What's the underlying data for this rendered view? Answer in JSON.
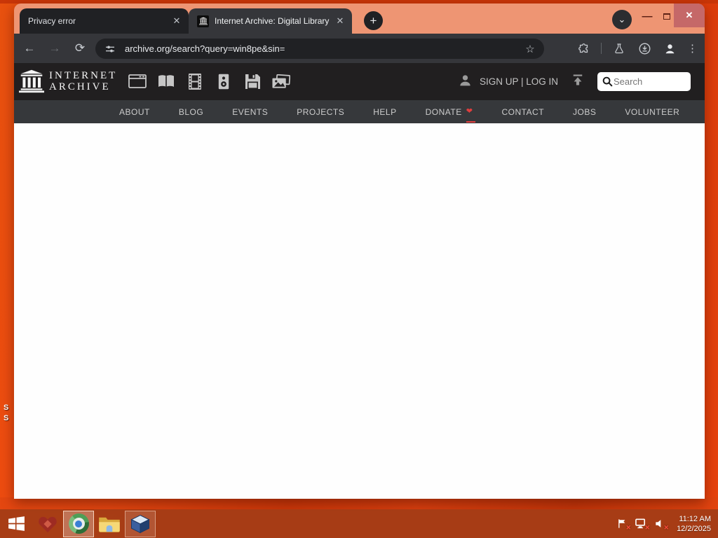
{
  "browser": {
    "tabs": [
      {
        "title": "Privacy error",
        "active": false
      },
      {
        "title": "Internet Archive: Digital Library",
        "active": true
      }
    ],
    "url": "archive.org/search?query=win8pe&sin=",
    "icons": {
      "tab_close": "✕",
      "new_tab": "+",
      "tab_search_chevron": "⌄",
      "minimize": "—",
      "window_close": "✕",
      "back": "←",
      "forward": "→",
      "reload": "⟳",
      "bookmark_star": "☆",
      "menu_dots": "⋮"
    }
  },
  "ia": {
    "logo": {
      "line1": "INTERNET",
      "line2": "ARCHIVE"
    },
    "media_types": [
      "web",
      "texts",
      "video",
      "audio",
      "software",
      "images"
    ],
    "auth": "SIGN UP | LOG IN",
    "search_placeholder": "Search",
    "nav": [
      "ABOUT",
      "BLOG",
      "EVENTS",
      "PROJECTS",
      "HELP",
      "DONATE",
      "CONTACT",
      "JOBS",
      "VOLUNTEER"
    ],
    "donate_heart": "❤"
  },
  "taskbar": {
    "clock": {
      "time": "11:12 AM",
      "date": "12/2/2025"
    }
  },
  "desktop": {
    "icon_label_fragments": [
      "S",
      "S"
    ]
  },
  "colors": {
    "desktop_orange": "#e8430d",
    "window_frame_salmon": "#ee9573",
    "chrome_dark_toolbar": "#35363a",
    "inactive_tab": "#202124",
    "close_button_patch": "#c56868",
    "donate_heart_red": "#e03e3e",
    "ia_header_bg": "#211f20",
    "ia_nav_bg": "#36383b"
  }
}
